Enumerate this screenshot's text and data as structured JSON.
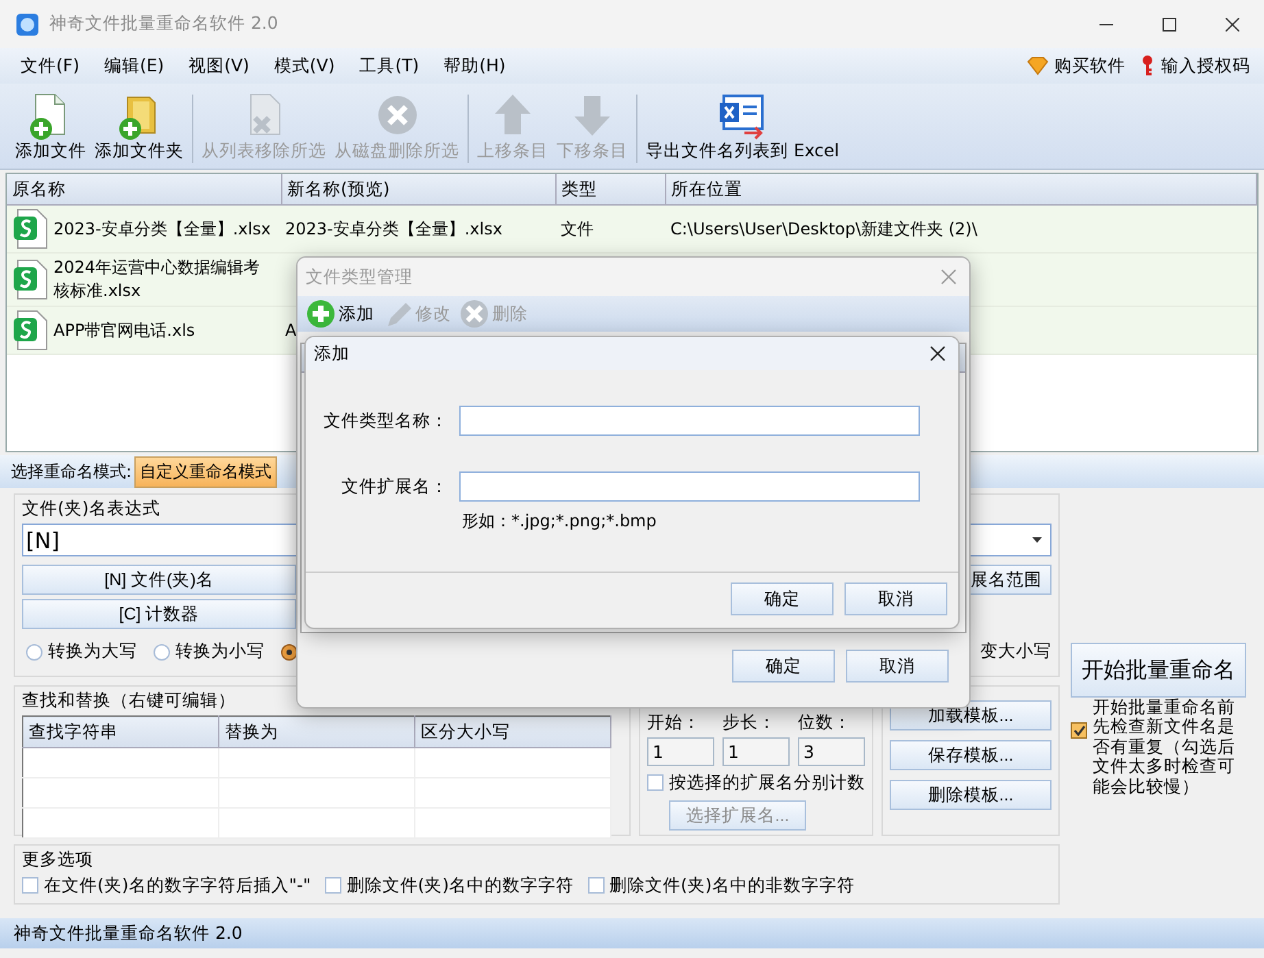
{
  "window": {
    "title": "神奇文件批量重命名软件 2.0"
  },
  "menu": [
    {
      "label": "文件(F)"
    },
    {
      "label": "编辑(E)"
    },
    {
      "label": "视图(V)"
    },
    {
      "label": "模式(V)"
    },
    {
      "label": "工具(T)"
    },
    {
      "label": "帮助(H)"
    }
  ],
  "menu_right": [
    {
      "label": "购买软件",
      "kind": "gem"
    },
    {
      "label": "输入授权码",
      "kind": "key"
    }
  ],
  "toolbar": [
    {
      "label": "添加文件",
      "kind": "addfile",
      "disabled": false
    },
    {
      "label": "添加文件夹",
      "kind": "addfolder",
      "disabled": false
    },
    {
      "label": "从列表移除所选",
      "kind": "remove",
      "disabled": true
    },
    {
      "label": "从磁盘删除所选",
      "kind": "delete",
      "disabled": true
    },
    {
      "label": "上移条目",
      "kind": "up",
      "disabled": true
    },
    {
      "label": "下移条目",
      "kind": "down",
      "disabled": true
    },
    {
      "label": "导出文件名列表到 Excel",
      "kind": "excel",
      "disabled": false
    }
  ],
  "file_table": {
    "columns": [
      "原名称",
      "新名称(预览)",
      "类型",
      "所在位置"
    ],
    "rows": [
      {
        "original": "2023-安卓分类【全量】.xlsx",
        "new_name": "2023-安卓分类【全量】.xlsx",
        "type": "文件",
        "location": "C:\\Users\\User\\Desktop\\新建文件夹 (2)\\"
      },
      {
        "original": "2024年运营中心数据编辑考核标准.xlsx"
      },
      {
        "original": "APP带官网电话.xls",
        "new_name": "A"
      }
    ]
  },
  "mode_bar": {
    "label": "选择重命名模式:",
    "tabs": [
      {
        "label": "自定义重命名模式",
        "selected": true
      }
    ]
  },
  "name_expression": {
    "title": "文件(夹)名表达式",
    "value": "[N]",
    "buttons": [
      "[N] 文件(夹)名",
      "[C] 计数器"
    ],
    "range_button": "展名范围",
    "case_options": [
      {
        "label": "转换为大写",
        "selected": false
      },
      {
        "label": "转换为小写",
        "selected": false
      },
      {
        "selected": true
      }
    ],
    "case_partial_label": "变大小写"
  },
  "find_replace": {
    "title": "查找和替换（右键可编辑）",
    "columns": [
      "查找字符串",
      "替换为",
      "区分大小写"
    ]
  },
  "counter": {
    "fields": [
      {
        "label": "开始：",
        "value": "1"
      },
      {
        "label": "步长：",
        "value": "1"
      },
      {
        "label": "位数：",
        "value": "3"
      }
    ],
    "per_extension": {
      "label": "按选择的扩展名分别计数",
      "checked": false
    },
    "select_button": {
      "label": "选择扩展名...",
      "disabled": true
    }
  },
  "templates": [
    "加载模板...",
    "保存模板...",
    "删除模板..."
  ],
  "start_button": "开始批量重命名",
  "check_duplicates": {
    "label": "开始批量重命名前先检查新文件名是否有重复（勾选后文件太多时检查可能会比较慢）",
    "checked": true
  },
  "more_options": {
    "title": "更多选项",
    "options": [
      {
        "label": "在文件(夹)名的数字字符后插入\"-\"",
        "checked": false
      },
      {
        "label": "删除文件(夹)名中的数字字符",
        "checked": false
      },
      {
        "label": "删除文件(夹)名中的非数字字符",
        "checked": false
      }
    ]
  },
  "status_bar": "神奇文件批量重命名软件 2.0",
  "type_dialog": {
    "title": "文件类型管理",
    "toolbar": [
      {
        "label": "添加",
        "kind": "add",
        "disabled": false
      },
      {
        "label": "修改",
        "kind": "edit",
        "disabled": true
      },
      {
        "label": "删除",
        "kind": "delete",
        "disabled": true
      }
    ],
    "buttons": [
      "确定",
      "取消"
    ]
  },
  "add_dialog": {
    "title": "添加",
    "fields": [
      {
        "label": "文件类型名称："
      },
      {
        "label": "文件扩展名："
      }
    ],
    "hint": "形如：*.jpg;*.png;*.bmp",
    "buttons": [
      "确定",
      "取消"
    ]
  }
}
